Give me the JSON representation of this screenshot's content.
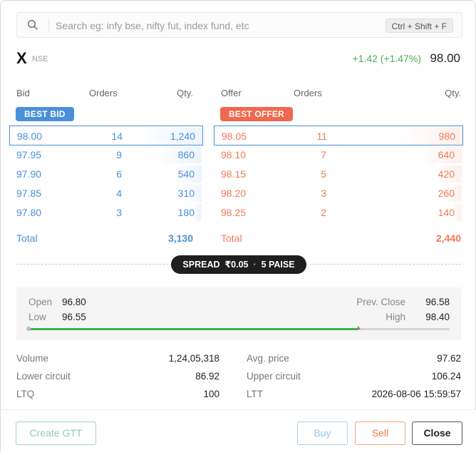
{
  "search": {
    "placeholder": "Search eg: infy bse, nifty fut, index fund, etc",
    "shortcut": "Ctrl + Shift + F"
  },
  "instrument": {
    "symbol": "X",
    "exchange": "NSE",
    "change": "+1.42 (+1.47%)",
    "ltp": "98.00",
    "change_color": "#4caf50"
  },
  "depth": {
    "bid_headers": [
      "Bid",
      "Orders",
      "Qty."
    ],
    "offer_headers": [
      "Offer",
      "Orders",
      "Qty."
    ],
    "best_bid_label": "BEST BID",
    "best_offer_label": "BEST OFFER",
    "bids": [
      {
        "price": "98.00",
        "orders": "14",
        "qty": "1,240",
        "qty_value": 1240
      },
      {
        "price": "97.95",
        "orders": "9",
        "qty": "860",
        "qty_value": 860
      },
      {
        "price": "97.90",
        "orders": "6",
        "qty": "540",
        "qty_value": 540
      },
      {
        "price": "97.85",
        "orders": "4",
        "qty": "310",
        "qty_value": 310
      },
      {
        "price": "97.80",
        "orders": "3",
        "qty": "180",
        "qty_value": 180
      }
    ],
    "offers": [
      {
        "price": "98.05",
        "orders": "11",
        "qty": "980",
        "qty_value": 980
      },
      {
        "price": "98.10",
        "orders": "7",
        "qty": "640",
        "qty_value": 640
      },
      {
        "price": "98.15",
        "orders": "5",
        "qty": "420",
        "qty_value": 420
      },
      {
        "price": "98.20",
        "orders": "3",
        "qty": "260",
        "qty_value": 260
      },
      {
        "price": "98.25",
        "orders": "2",
        "qty": "140",
        "qty_value": 140
      }
    ],
    "total_label": "Total",
    "bid_total": "3,130",
    "offer_total": "2,440",
    "bid_color": "#4a90d9",
    "offer_color": "#f0684f"
  },
  "spread": {
    "label": "SPREAD",
    "value": "₹0.05",
    "separator": "·",
    "paise": "5 PAISE"
  },
  "ohlc": {
    "open_label": "Open",
    "open": "96.80",
    "low_label": "Low",
    "low": "96.55",
    "prev_close_label": "Prev. Close",
    "prev_close": "96.58",
    "high_label": "High",
    "high": "98.40",
    "range_low": 96.55,
    "range_high": 98.4,
    "ltp_value": 98.0,
    "range_color": "#39b54a"
  },
  "stats": {
    "volume_label": "Volume",
    "volume": "1,24,05,318",
    "avg_label": "Avg. price",
    "avg": "97.62",
    "lower_label": "Lower circuit",
    "lower": "86.92",
    "upper_label": "Upper circuit",
    "upper": "106.24",
    "ltq_label": "LTQ",
    "ltq": "100",
    "ltt_label": "LTT",
    "ltt": "2026-08-06 15:59:57"
  },
  "actions": {
    "gtt": "Create GTT",
    "buy": "Buy",
    "sell": "Sell",
    "close": "Close"
  }
}
